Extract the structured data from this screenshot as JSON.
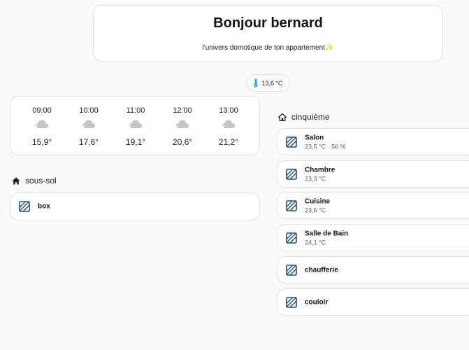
{
  "header": {
    "title": "Bonjour bernard",
    "subtitle": "l'univers domotique de ton appartement✨"
  },
  "outdoor_temperature": {
    "value": "13,6 °C",
    "icon": "thermometer-icon",
    "color": "#03a9f4"
  },
  "forecast": [
    {
      "time": "09:00",
      "icon": "cloudy-icon",
      "temp": "15,9°"
    },
    {
      "time": "10:00",
      "icon": "cloudy-icon",
      "temp": "17,6°"
    },
    {
      "time": "11:00",
      "icon": "cloudy-icon",
      "temp": "19,1°"
    },
    {
      "time": "12:00",
      "icon": "cloudy-icon",
      "temp": "20,6°"
    },
    {
      "time": "13:00",
      "icon": "cloudy-icon",
      "temp": "21,2°"
    }
  ],
  "areas": {
    "basement": {
      "title": "sous-sol",
      "icon": "home-icon",
      "rooms": [
        {
          "name": "box",
          "state": ""
        }
      ]
    },
    "fifth_floor": {
      "title": "cinquième",
      "icon": "home-outline-icon",
      "rooms": [
        {
          "name": "Salon",
          "state": "23,5 °C · 56 %"
        },
        {
          "name": "Chambre",
          "state": "23,3 °C"
        },
        {
          "name": "Cuisine",
          "state": "23,6 °C"
        },
        {
          "name": "Salle de Bain",
          "state": "24,1 °C"
        },
        {
          "name": "chaufferie",
          "state": ""
        },
        {
          "name": "couloir",
          "state": ""
        }
      ]
    }
  },
  "colors": {
    "room_icon": "#1d4f79",
    "cloud_icon": "#c4c4c4"
  }
}
